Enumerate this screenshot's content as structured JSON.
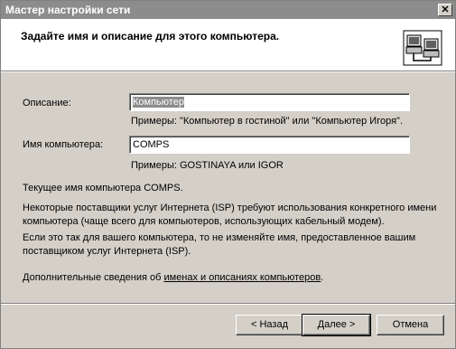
{
  "window": {
    "title": "Мастер настройки сети",
    "close_glyph": "✕"
  },
  "header": {
    "heading": "Задайте имя и описание для этого компьютера.",
    "icon": "network-computers-icon"
  },
  "form": {
    "description_label": "Описание:",
    "description_value": "Компьютер",
    "description_hint": "Примеры: \"Компьютер в гостиной\" или \"Компьютер Игоря\".",
    "computer_name_label": "Имя компьютера:",
    "computer_name_value": "COMPS",
    "computer_name_hint": "Примеры: GOSTINAYA или IGOR"
  },
  "info": {
    "current_name": "Текущее имя компьютера COMPS.",
    "isp_note": "Некоторые поставщики услуг Интернета (ISP) требуют использования конкретного имени компьютера (чаще всего для компьютеров, использующих кабельный модем).",
    "isp_advice": "Если это так для вашего компьютера, то не изменяйте имя, предоставленное вашим поставщиком услуг Интернета (ISP).",
    "more_info_prefix": "Дополнительные сведения об ",
    "more_info_link": "именах и описаниях компьютеров",
    "more_info_suffix": "."
  },
  "buttons": {
    "back": "< Назад",
    "next": "Далее >",
    "cancel": "Отмена"
  }
}
